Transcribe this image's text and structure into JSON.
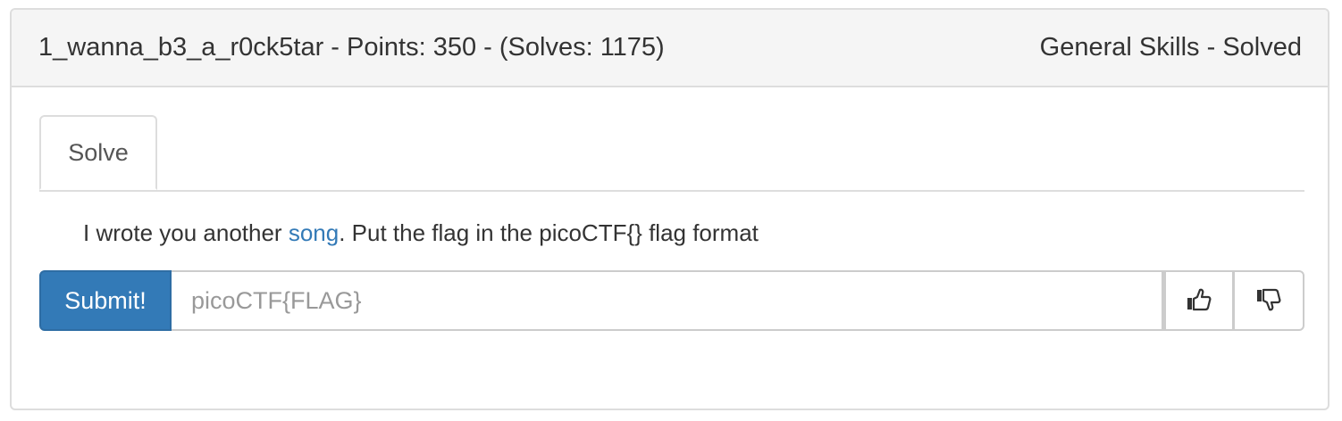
{
  "challenge": {
    "title": "1_wanna_b3_a_r0ck5tar - Points: 350 - (Solves: 1175)",
    "category_status": "General Skills - Solved"
  },
  "tabs": [
    {
      "label": "Solve"
    }
  ],
  "description": {
    "before_link": "I wrote you another ",
    "link_text": "song",
    "after_link": ". Put the flag in the picoCTF{} flag format"
  },
  "form": {
    "submit_label": "Submit!",
    "flag_placeholder": "picoCTF{FLAG}",
    "flag_value": ""
  },
  "icons": {
    "upvote": "thumbs-up-icon",
    "downvote": "thumbs-down-icon"
  },
  "colors": {
    "primary": "#337ab7",
    "link": "#337ab7",
    "heading_bg": "#f5f5f5",
    "border": "#dddddd"
  }
}
